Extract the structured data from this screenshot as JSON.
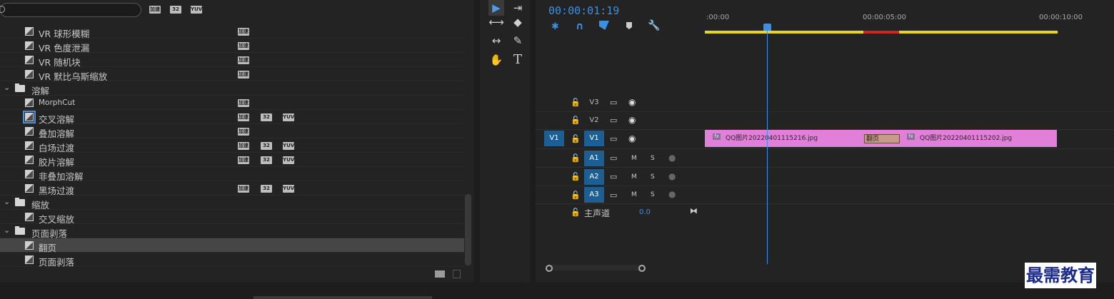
{
  "effects_panel": {
    "search_placeholder": "",
    "header_badges": [
      "加速",
      "32",
      "YUV"
    ],
    "items": [
      {
        "type": "effect",
        "label": "VR 球形模糊",
        "badges": [
          "加速"
        ]
      },
      {
        "type": "effect",
        "label": "VR 色度泄漏",
        "badges": [
          "加速"
        ]
      },
      {
        "type": "effect",
        "label": "VR 随机块",
        "badges": [
          "加速"
        ]
      },
      {
        "type": "effect",
        "label": "VR 默比乌斯缩放",
        "badges": [
          "加速"
        ]
      },
      {
        "type": "folder",
        "label": "溶解"
      },
      {
        "type": "effect",
        "label": "MorphCut",
        "badges": [
          "加速"
        ]
      },
      {
        "type": "effect",
        "label": "交叉溶解",
        "badges": [
          "加速",
          "32",
          "YUV"
        ],
        "highlighted": true
      },
      {
        "type": "effect",
        "label": "叠加溶解",
        "badges": [
          "加速"
        ]
      },
      {
        "type": "effect",
        "label": "白场过渡",
        "badges": [
          "加速",
          "32",
          "YUV"
        ]
      },
      {
        "type": "effect",
        "label": "胶片溶解",
        "badges": [
          "加速",
          "32",
          "YUV"
        ]
      },
      {
        "type": "effect",
        "label": "非叠加溶解",
        "badges": []
      },
      {
        "type": "effect",
        "label": "黑场过渡",
        "badges": [
          "加速",
          "32",
          "YUV"
        ]
      },
      {
        "type": "folder",
        "label": "缩放"
      },
      {
        "type": "effect",
        "label": "交叉缩放",
        "badges": []
      },
      {
        "type": "folder",
        "label": "页面剥落"
      },
      {
        "type": "effect",
        "label": "翻页",
        "badges": [],
        "selected": true
      },
      {
        "type": "effect",
        "label": "页面剥落",
        "badges": []
      }
    ]
  },
  "tools": {
    "icons": [
      "selection-tool-icon",
      "track-select-tool-icon",
      "ripple-edit-tool-icon",
      "razor-tool-icon",
      "slip-tool-icon",
      "pen-tool-icon",
      "hand-tool-icon",
      "type-tool-icon"
    ],
    "type_label": "T"
  },
  "timeline": {
    "timecode": "00:00:01:19",
    "ruler_labels": [
      ":00:00",
      "00:00:05:00",
      "00:00:10:00"
    ],
    "tracks": {
      "video": [
        {
          "name": "V3",
          "source": ""
        },
        {
          "name": "V2",
          "source": ""
        },
        {
          "name": "V1",
          "source": "V1"
        }
      ],
      "audio": [
        {
          "name": "A1",
          "m": "M",
          "s": "S"
        },
        {
          "name": "A2",
          "m": "M",
          "s": "S"
        },
        {
          "name": "A3",
          "m": "M",
          "s": "S"
        }
      ],
      "master": {
        "label": "主声道",
        "value": "0.0"
      }
    },
    "clips": [
      {
        "name": "QQ图片20220401115216.jpg",
        "fx": "fx"
      },
      {
        "name": "QQ图片20220401115202.jpg",
        "fx": "fx"
      }
    ],
    "transition": "翻页"
  },
  "watermark": "最需教育",
  "colors": {
    "accent": "#3b8fe6",
    "clip": "#e27fd9",
    "workarea": "#e5d822",
    "track_active": "#1e5f93"
  }
}
